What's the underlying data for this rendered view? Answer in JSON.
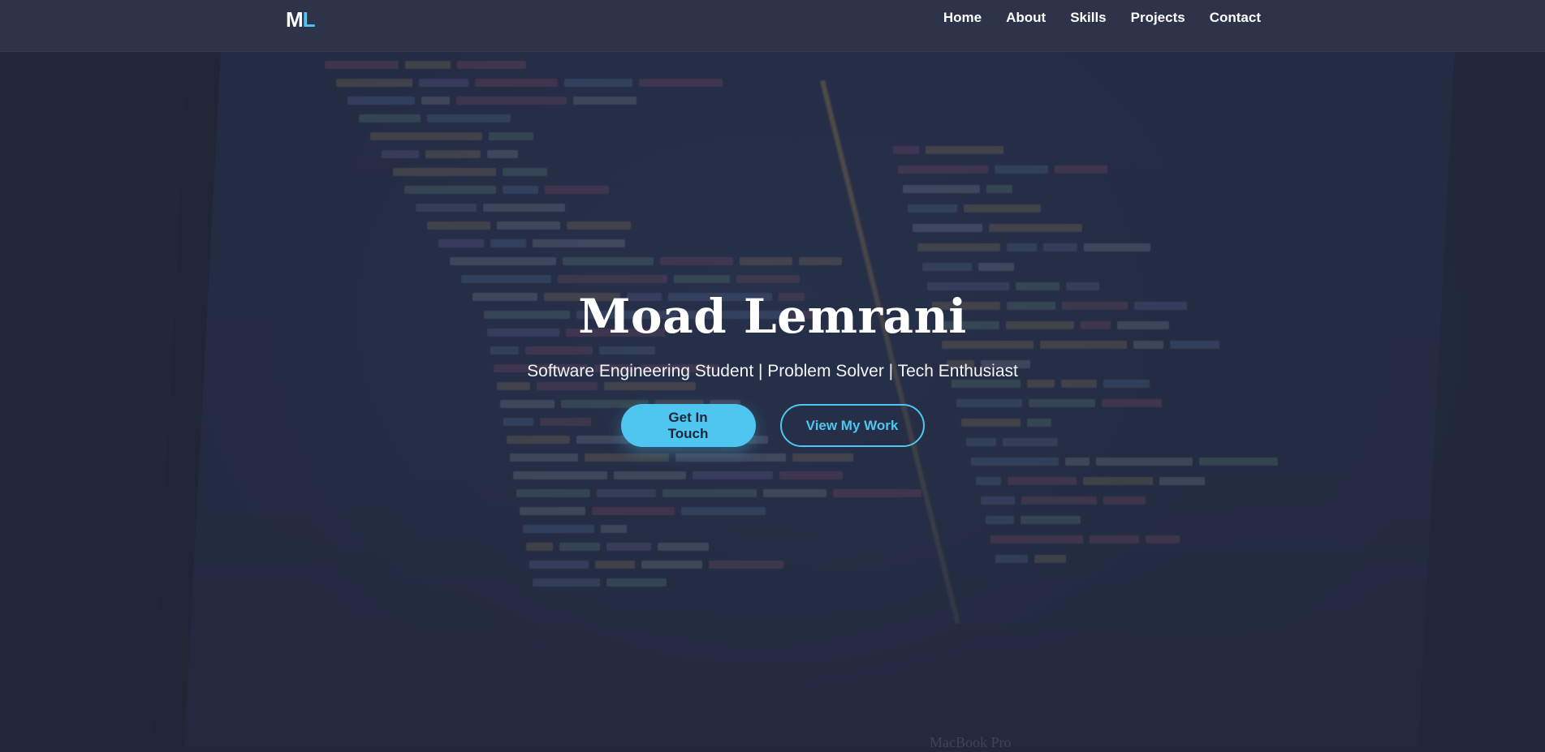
{
  "brand": {
    "logo_first": "M",
    "logo_second": "L",
    "accent_color": "#4ec6ef"
  },
  "nav": {
    "items": [
      {
        "label": "Home"
      },
      {
        "label": "About"
      },
      {
        "label": "Skills"
      },
      {
        "label": "Projects"
      },
      {
        "label": "Contact"
      }
    ]
  },
  "hero": {
    "name": "Moad Lemrani",
    "tagline": "Software Engineering Student | Problem Solver | Tech Enthusiast",
    "primary_button": "Get In Touch",
    "secondary_button": "View My Work",
    "background_text": "MacBook Pro"
  },
  "colors": {
    "background": "#232a3e",
    "navbar": "#2e344a",
    "accent": "#4ec6ef",
    "text": "#ffffff"
  }
}
